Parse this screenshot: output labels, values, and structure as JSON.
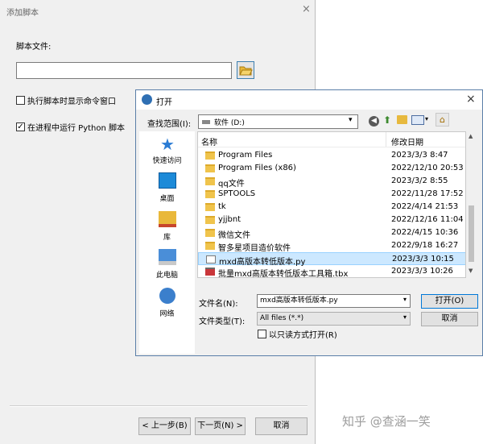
{
  "wizard": {
    "title": "添加脚本",
    "close": "×",
    "script_file_label": "脚本文件:",
    "path_value": "",
    "checkbox_show_cmd": {
      "label": "执行脚本时显示命令窗口",
      "checked": false
    },
    "checkbox_in_process": {
      "label": "在进程中运行 Python 脚本",
      "checked": true,
      "mark": "✓"
    },
    "buttons": {
      "prev": "< 上一步(B)",
      "next": "下一页(N) >",
      "cancel": "取消"
    }
  },
  "open_dialog": {
    "title": "打开",
    "close": "×",
    "lookin_label": "查找范围(I):",
    "lookin_value": "软件 (D:)",
    "toolbar": {
      "back": "◀",
      "up": "⬆",
      "home": "⌂",
      "dropdown": "▾"
    },
    "places": [
      {
        "label": "快速访问",
        "icon": "star-icon"
      },
      {
        "label": "桌面",
        "icon": "desktop-icon"
      },
      {
        "label": "库",
        "icon": "library-icon"
      },
      {
        "label": "此电脑",
        "icon": "computer-icon"
      },
      {
        "label": "网络",
        "icon": "network-icon"
      }
    ],
    "columns": {
      "name": "名称",
      "date": "修改日期"
    },
    "files": [
      {
        "name": "Program Files",
        "date": "2023/3/3 8:47",
        "type": "folder"
      },
      {
        "name": "Program Files (x86)",
        "date": "2022/12/10 20:53",
        "type": "folder"
      },
      {
        "name": "qq文件",
        "date": "2023/3/2 8:55",
        "type": "folder"
      },
      {
        "name": "SPTOOLS",
        "date": "2022/11/28 17:52",
        "type": "folder"
      },
      {
        "name": "tk",
        "date": "2022/4/14 21:53",
        "type": "folder"
      },
      {
        "name": "yjjbnt",
        "date": "2022/12/16 11:04",
        "type": "folder"
      },
      {
        "name": "微信文件",
        "date": "2022/4/15 10:36",
        "type": "folder"
      },
      {
        "name": "智多星项目造价软件",
        "date": "2022/9/18 16:27",
        "type": "folder"
      },
      {
        "name": "mxd高版本转低版本.py",
        "date": "2023/3/3 10:15",
        "type": "py",
        "selected": true
      },
      {
        "name": "批量mxd高版本转低版本工具箱.tbx",
        "date": "2023/3/3 10:26",
        "type": "tbx"
      }
    ],
    "filename_label": "文件名(N):",
    "filename_value": "mxd高版本转低版本.py",
    "filetype_label": "文件类型(T):",
    "filetype_value": "All files (*.*)",
    "readonly_label": "以只读方式打开(R)",
    "readonly_checked": false,
    "open_button": "打开(O)",
    "cancel_button": "取消"
  },
  "watermark": "知乎 @查涵一笑"
}
